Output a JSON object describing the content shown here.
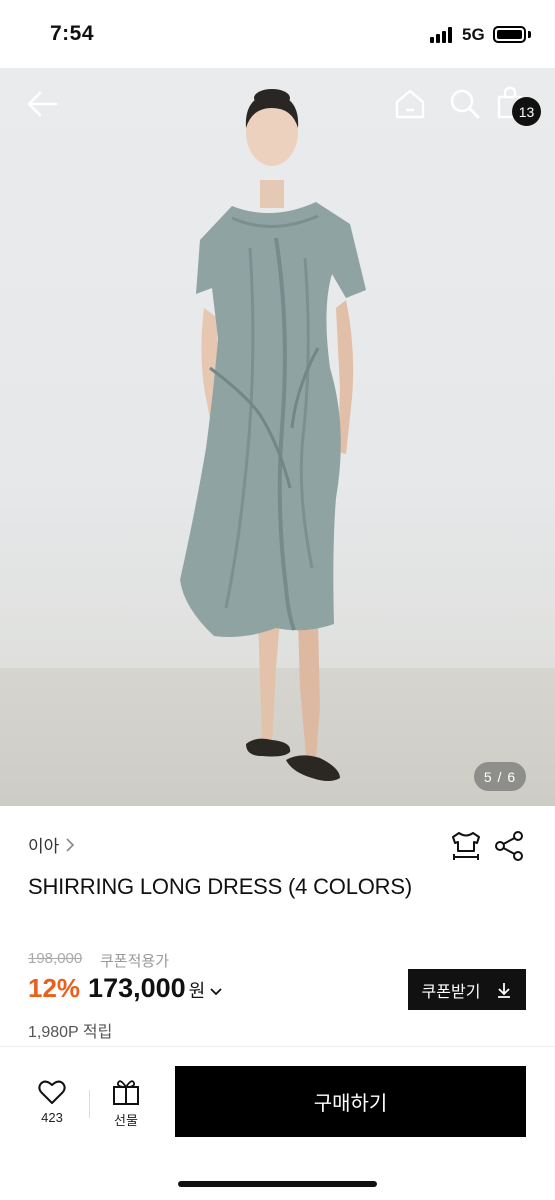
{
  "status_bar": {
    "time": "7:54",
    "network": "5G"
  },
  "top_nav": {
    "cart_count": "13",
    "icons": [
      "back-arrow-icon",
      "home-icon",
      "search-icon",
      "shopping-bag-icon"
    ]
  },
  "gallery": {
    "indicator": "5 / 6"
  },
  "product": {
    "brand": "이아",
    "title": "SHIRRING LONG DRESS (4 COLORS)",
    "original_price": "198,000",
    "coupon_note": "쿠폰적용가",
    "discount": "12%",
    "price": "173,000",
    "currency": "원",
    "points": "1,980P 적립"
  },
  "coupon_button": {
    "label": "쿠폰받기"
  },
  "bottom_bar": {
    "like_count": "423",
    "gift_label": "선물",
    "buy_label": "구매하기"
  },
  "colors": {
    "discount": "#e8601c",
    "primary_button": "#000000",
    "dress": "#8ea3a2"
  }
}
